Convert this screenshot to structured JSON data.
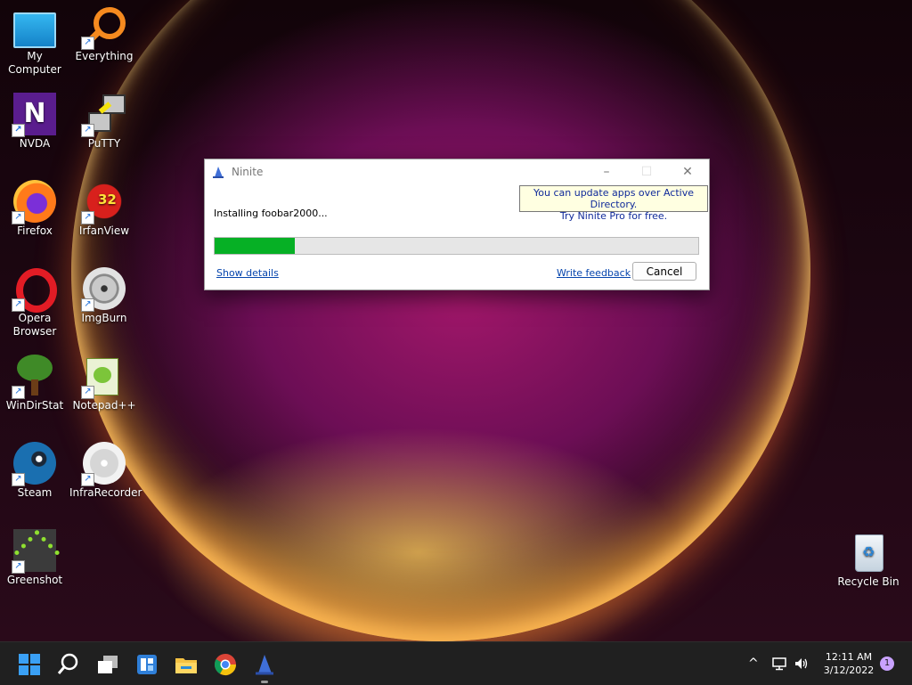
{
  "desktop": {
    "icons": [
      {
        "label": "My Computer"
      },
      {
        "label": "Everything"
      },
      {
        "label": "NVDA"
      },
      {
        "label": "PuTTY"
      },
      {
        "label": "Firefox"
      },
      {
        "label": "IrfanView"
      },
      {
        "label": "Opera Browser"
      },
      {
        "label": "ImgBurn"
      },
      {
        "label": "WinDirStat"
      },
      {
        "label": "Notepad++"
      },
      {
        "label": "Steam"
      },
      {
        "label": "InfraRecorder"
      },
      {
        "label": "Greenshot"
      },
      {
        "label": "Recycle Bin"
      }
    ],
    "irfanview_badge": "32"
  },
  "dialog": {
    "title": "Ninite",
    "tooltip_line1": "You can update apps over Active Directory.",
    "tooltip_line2": "Try Ninite Pro for free.",
    "status": "Installing foobar2000...",
    "progress_percent": 16.5,
    "show_details": "Show details",
    "write_feedback": "Write feedback",
    "cancel": "Cancel",
    "minimize_glyph": "–",
    "maximize_glyph": "☐",
    "close_glyph": "✕"
  },
  "taskbar": {
    "time": "12:11 AM",
    "date": "3/12/2022",
    "notification_count": "1",
    "chevron_glyph": "^"
  },
  "colors": {
    "progress_fill": "#06b025",
    "link": "#0645ad",
    "tooltip_bg": "#ffffe1",
    "taskbar": "#202020"
  }
}
